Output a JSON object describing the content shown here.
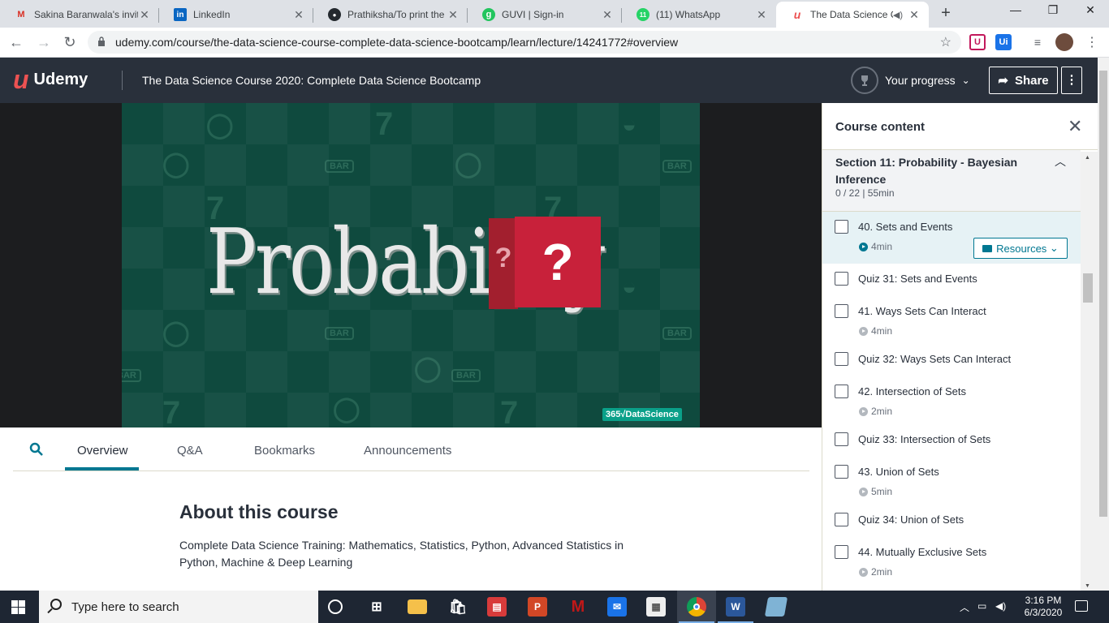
{
  "browser": {
    "tabs": [
      {
        "title": "Sakina Baranwala's invit",
        "icon": "gmail-icon",
        "color": "#d93025",
        "glyph": "M"
      },
      {
        "title": "LinkedIn",
        "icon": "linkedin-icon",
        "color": "#0a66c2",
        "glyph": "in"
      },
      {
        "title": "Prathiksha/To print the",
        "icon": "github-icon",
        "color": "#24292e",
        "glyph": "●"
      },
      {
        "title": "GUVI | Sign-in",
        "icon": "guvi-icon",
        "color": "#22c55e",
        "glyph": "g"
      },
      {
        "title": "(11) WhatsApp",
        "icon": "whatsapp-icon",
        "color": "#25d366",
        "glyph": "11"
      },
      {
        "title": "The Data Science C",
        "icon": "udemy-icon",
        "color": "#ec5252",
        "glyph": "u"
      }
    ],
    "url": "udemy.com/course/the-data-science-course-complete-data-science-bootcamp/learn/lecture/14241772#overview",
    "extensions": [
      "U",
      "Ui"
    ]
  },
  "header": {
    "logo": "Udemy",
    "course_title": "The Data Science Course 2020: Complete Data Science Bootcamp",
    "progress_label": "Your progress",
    "share_label": "Share",
    "brand_color": "#ec5252"
  },
  "video": {
    "title_text": "Probability",
    "cube_glyph": "?",
    "cube_side_glyph": "?",
    "watermark": "365√DataScience",
    "bar_label": "BAR",
    "seven": "7"
  },
  "content_tabs": [
    "Overview",
    "Q&A",
    "Bookmarks",
    "Announcements"
  ],
  "about": {
    "heading": "About this course",
    "description": "Complete Data Science Training: Mathematics, Statistics, Python, Advanced Statistics in Python, Machine & Deep Learning"
  },
  "sidebar": {
    "title": "Course content",
    "section": {
      "title": "Section 11: Probability - Bayesian Inference",
      "meta": "0 / 22 | 55min"
    },
    "resources_label": "Resources",
    "items": [
      {
        "name": "40. Sets and Events",
        "duration": "4min"
      },
      {
        "name": "Quiz 31: Sets and Events",
        "duration": ""
      },
      {
        "name": "41. Ways Sets Can Interact",
        "duration": "4min"
      },
      {
        "name": "Quiz 32: Ways Sets Can Interact",
        "duration": ""
      },
      {
        "name": "42. Intersection of Sets",
        "duration": "2min"
      },
      {
        "name": "Quiz 33: Intersection of Sets",
        "duration": ""
      },
      {
        "name": "43. Union of Sets",
        "duration": "5min"
      },
      {
        "name": "Quiz 34: Union of Sets",
        "duration": ""
      },
      {
        "name": "44. Mutually Exclusive Sets",
        "duration": "2min"
      }
    ]
  },
  "taskbar": {
    "search_placeholder": "Type here to search",
    "time": "3:16 PM",
    "date": "6/3/2020",
    "apps": [
      "task-view-icon",
      "file-explorer-icon",
      "store-icon",
      "news-icon",
      "powerpoint-icon",
      "mcafee-icon",
      "mail-icon",
      "files-icon",
      "chrome-icon",
      "word-icon",
      "notes-icon"
    ]
  }
}
